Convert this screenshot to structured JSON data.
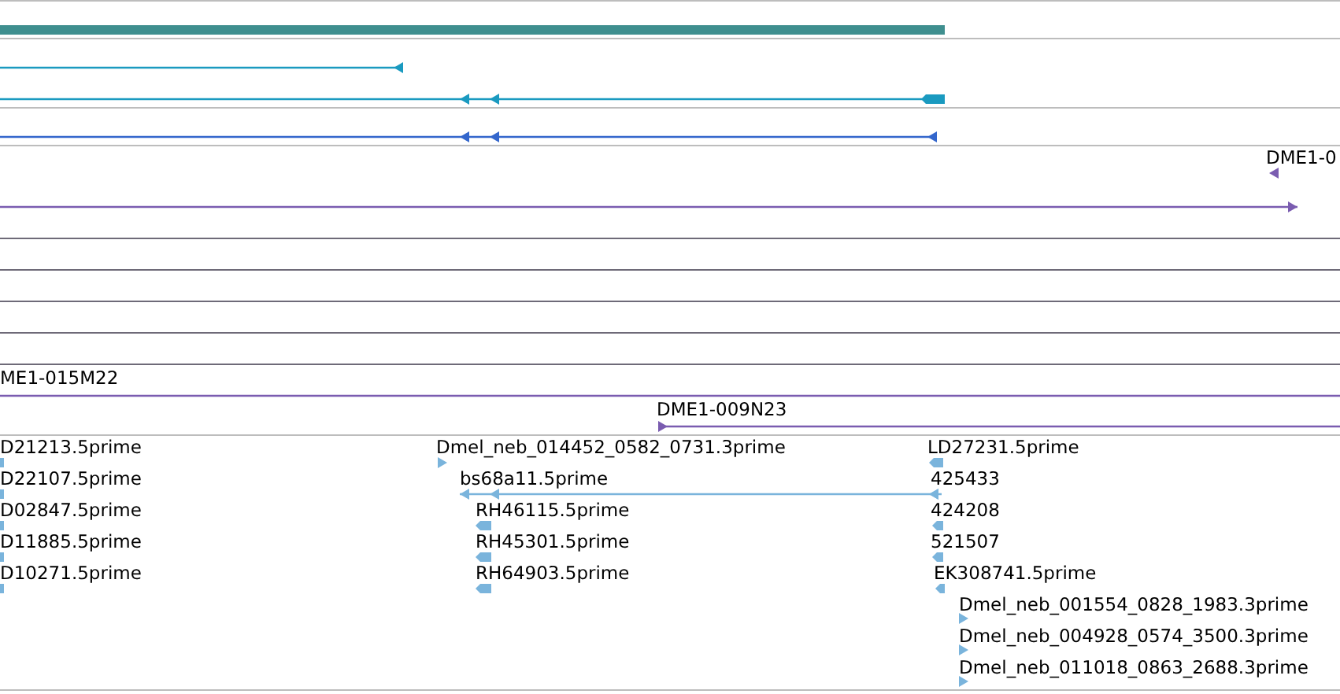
{
  "tracks": [
    {
      "kind": "bar",
      "color": "#3f8f8f"
    },
    {
      "kind": "transcript",
      "color": "#1a9ac0",
      "features": [
        {
          "reverse": true
        },
        {
          "reverse": true
        }
      ]
    },
    {
      "kind": "transcript",
      "color": "#3366cc",
      "features": [
        {
          "reverse": true
        }
      ]
    },
    {
      "kind": "clone",
      "color": "#7a5cb0",
      "features": [
        {
          "label": "DME1-0",
          "reverse": true
        },
        {
          "reverse": false
        },
        {
          "label": "ME1-015M22"
        },
        {
          "label": "DME1-009N23",
          "reverse": false
        }
      ]
    },
    {
      "kind": "est",
      "color": "#7ab4dc",
      "features": [
        {
          "label": "D21213.5prime"
        },
        {
          "label": "D22107.5prime"
        },
        {
          "label": "D02847.5prime"
        },
        {
          "label": "D11885.5prime"
        },
        {
          "label": "D10271.5prime"
        },
        {
          "label": "Dmel_neb_014452_0582_0731.3prime",
          "reverse": false
        },
        {
          "label": "bs68a11.5prime",
          "reverse": true
        },
        {
          "label": "RH46115.5prime",
          "reverse": true
        },
        {
          "label": "RH45301.5prime",
          "reverse": true
        },
        {
          "label": "RH64903.5prime",
          "reverse": true
        },
        {
          "label": "LD27231.5prime",
          "reverse": true
        },
        {
          "label": "425433",
          "reverse": true
        },
        {
          "label": "424208",
          "reverse": true
        },
        {
          "label": "521507",
          "reverse": true
        },
        {
          "label": "EK308741.5prime",
          "reverse": true
        },
        {
          "label": "Dmel_neb_001554_0828_1983.3prime",
          "reverse": false
        },
        {
          "label": "Dmel_neb_004928_0574_3500.3prime",
          "reverse": false
        },
        {
          "label": "Dmel_neb_011018_0863_2688.3prime",
          "reverse": false
        }
      ]
    }
  ]
}
